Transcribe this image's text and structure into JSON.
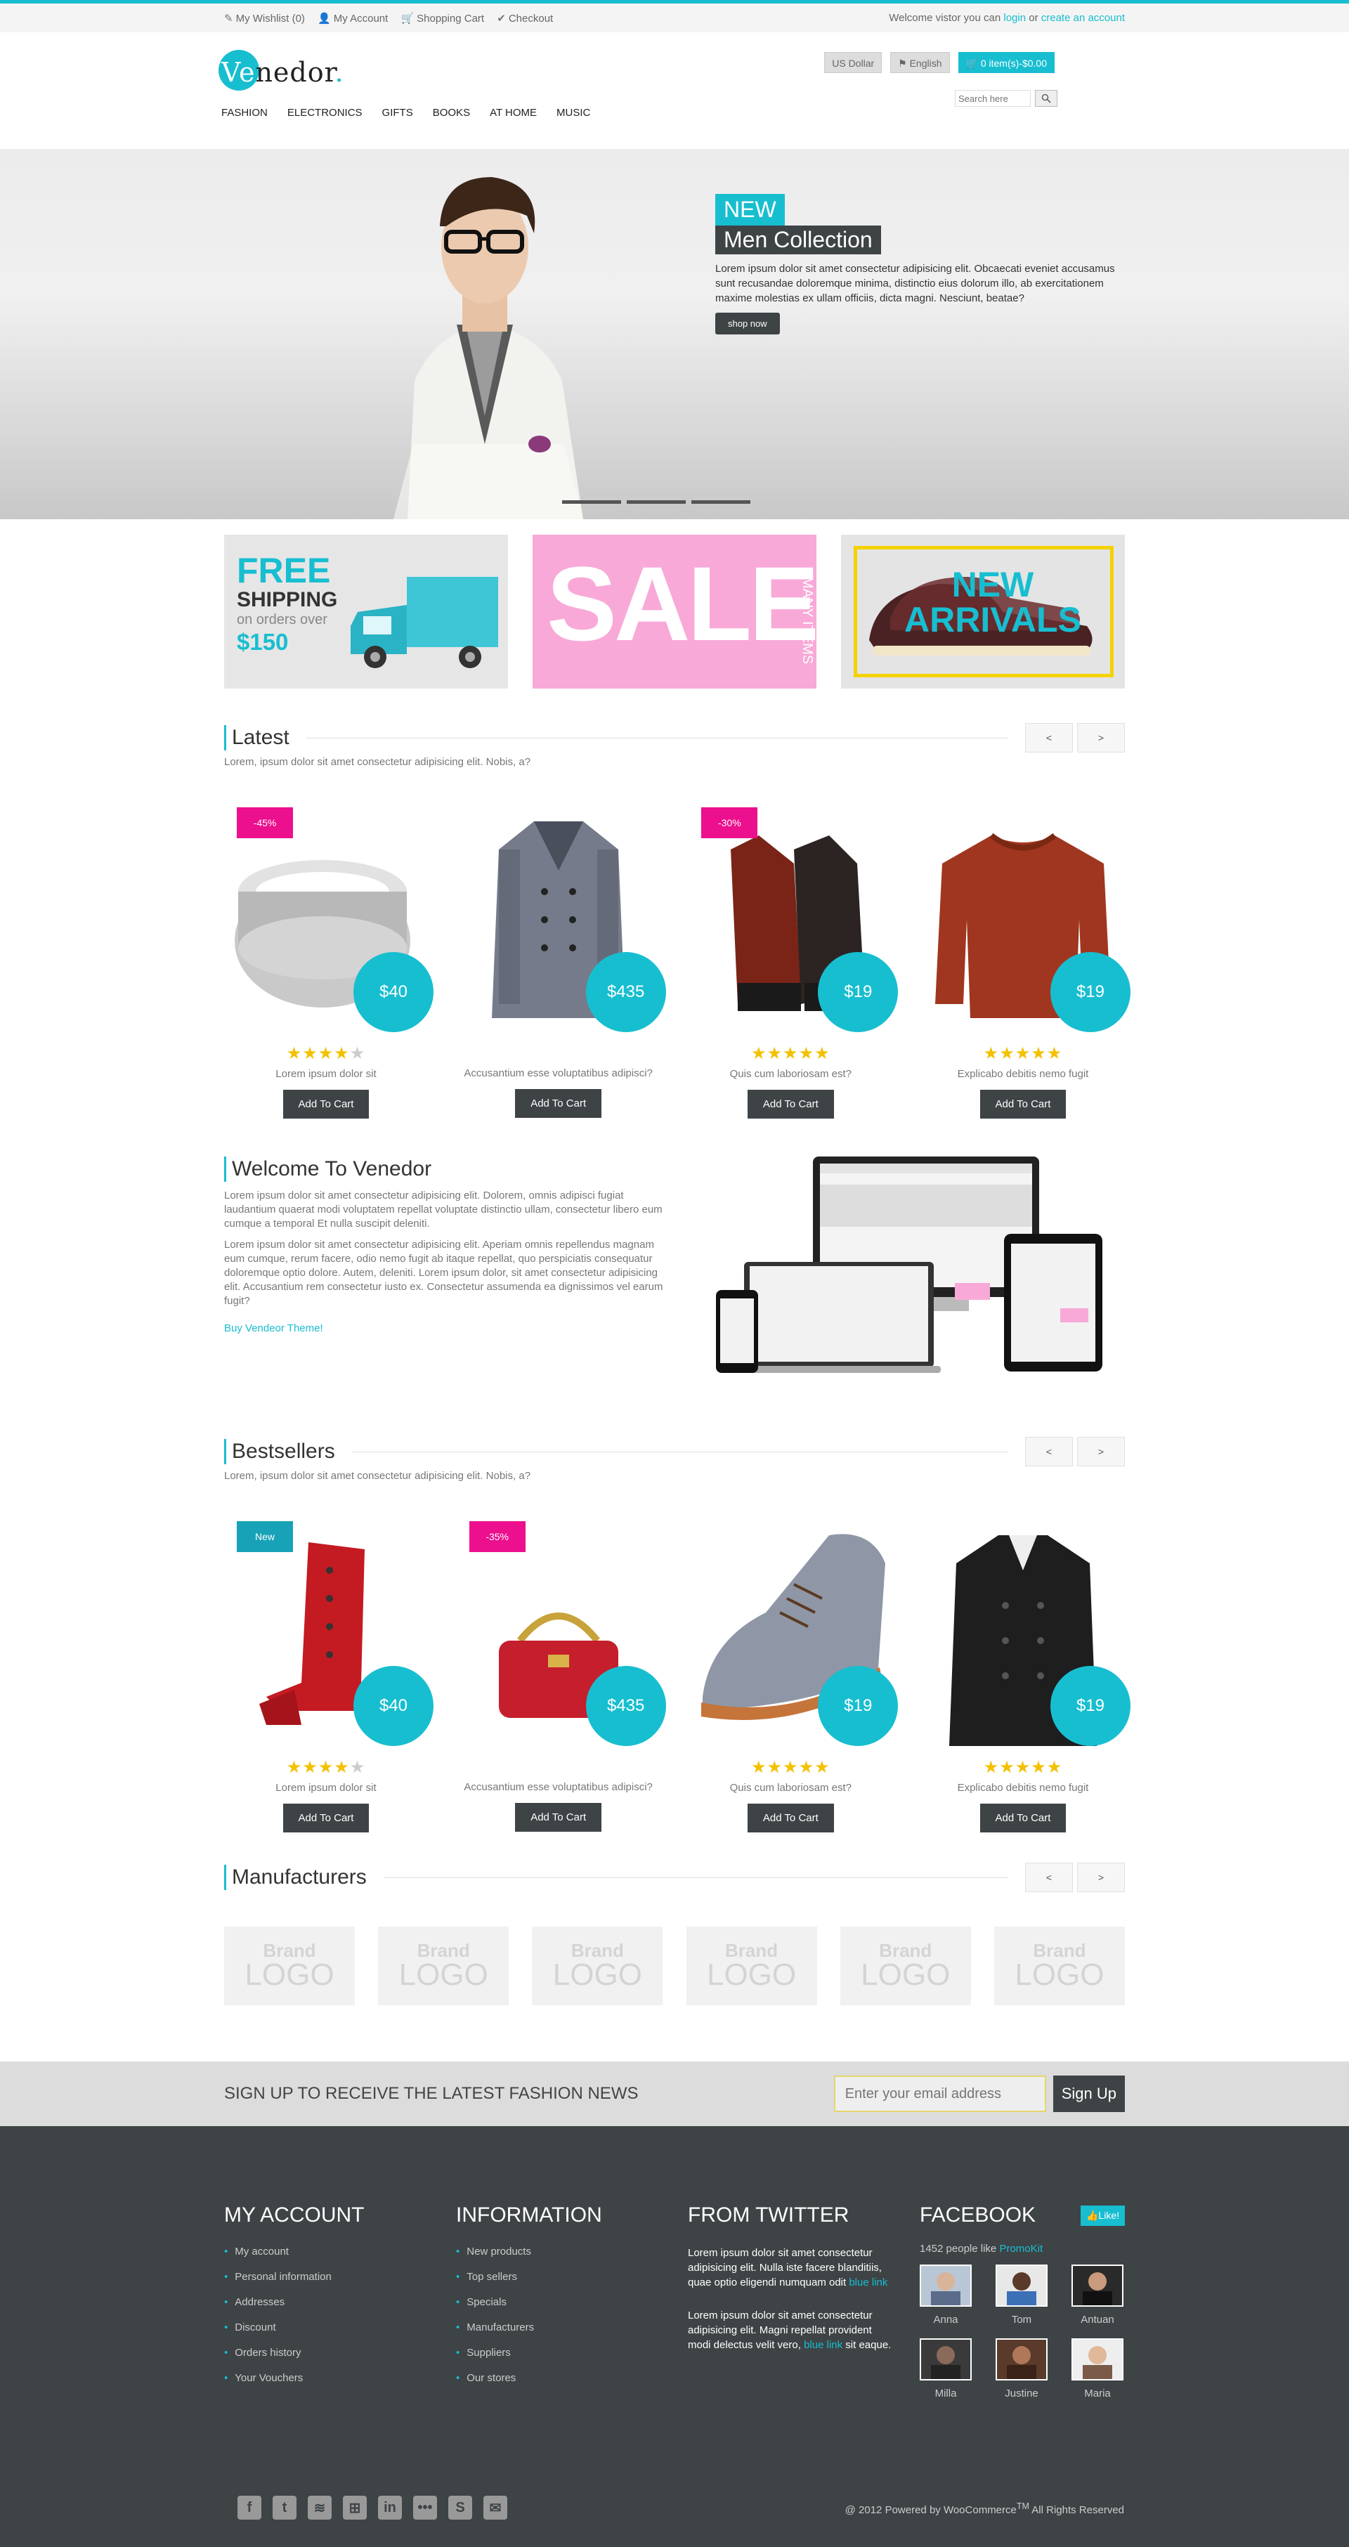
{
  "topbar": {
    "links": [
      "My Wishlist (0)",
      "My Account",
      "Shopping Cart",
      "Checkout"
    ],
    "welcome_text": "Welcome vistor you can",
    "login": "login",
    "or": "or",
    "create": "create an account"
  },
  "header": {
    "logo_ve": "Ve",
    "logo_rest": "nedor",
    "logo_dot": ".",
    "nav": [
      "FASHION",
      "ELECTRONICS",
      "GIFTS",
      "BOOKS",
      "AT HOME",
      "MUSIC"
    ],
    "currency": "US Dollar",
    "language": "English",
    "cart": "0 item(s)-$0.00",
    "search_placeholder": "Search here"
  },
  "hero": {
    "tag": "NEW",
    "title": "Men Collection",
    "desc": "Lorem ipsum dolor sit amet consectetur adipisicing elit. Obcaecati eveniet accusamus sunt recusandae doloremque minima, distinctio eius dolorum illo, ab exercitationem maxime molestias ex ullam officiis, dicta magni. Nesciunt, beatae?",
    "button": "shop now"
  },
  "banners": {
    "free": "FREE",
    "shipping": "SHIPPING",
    "on_orders": "on orders over",
    "amount": "$150",
    "sale": "SALE",
    "many": "MANY ITEMS",
    "new_arrivals_1": "NEW",
    "new_arrivals_2": "ARRIVALS"
  },
  "latest": {
    "title": "Latest",
    "sub": "Lorem, ipsum dolor sit amet consectetur adipisicing elit. Nobis, a?",
    "prev": "<",
    "next": ">",
    "products": [
      {
        "badge": "-45%",
        "price": "$40",
        "rating": 4,
        "name": "Lorem ipsum dolor sit",
        "cart": "Add To Cart"
      },
      {
        "badge": "",
        "price": "$435",
        "rating": 0,
        "name": "Accusantium esse voluptatibus adipisci?",
        "cart": "Add To Cart"
      },
      {
        "badge": "-30%",
        "price": "$19",
        "rating": 5,
        "name": "Quis cum laboriosam est?",
        "cart": "Add To Cart"
      },
      {
        "badge": "",
        "price": "$19",
        "rating": 5,
        "name": "Explicabo debitis nemo fugit",
        "cart": "Add To Cart"
      }
    ]
  },
  "welcome": {
    "title": "Welcome To Venedor",
    "p1": "Lorem ipsum dolor sit amet consectetur adipisicing elit. Dolorem, omnis adipisci fugiat laudantium quaerat modi voluptatem repellat voluptate distinctio ullam, consectetur libero eum cumque a temporal Et nulla suscipit deleniti.",
    "p2": "Lorem ipsum dolor sit amet consectetur adipisicing elit. Aperiam omnis repellendus magnam eum cumque, rerum facere, odio nemo fugit ab itaque repellat, quo perspiciatis consequatur doloremque optio dolore. Autem, deleniti. Lorem ipsum dolor, sit amet consectetur adipisicing elit. Accusantium rem consectetur iusto ex. Consectetur assumenda ea dignissimos vel earum fugit?",
    "link": "Buy Vendeor Theme!"
  },
  "bestsellers": {
    "title": "Bestsellers",
    "sub": "Lorem, ipsum dolor sit amet consectetur adipisicing elit. Nobis, a?",
    "prev": "<",
    "next": ">",
    "products": [
      {
        "badge": "New",
        "price": "$40",
        "rating": 4,
        "name": "Lorem ipsum dolor sit",
        "cart": "Add To Cart"
      },
      {
        "badge": "-35%",
        "price": "$435",
        "rating": 0,
        "name": "Accusantium esse voluptatibus adipisci?",
        "cart": "Add To Cart"
      },
      {
        "badge": "",
        "price": "$19",
        "rating": 5,
        "name": "Quis cum laboriosam est?",
        "cart": "Add To Cart"
      },
      {
        "badge": "",
        "price": "$19",
        "rating": 5,
        "name": "Explicabo debitis nemo fugit",
        "cart": "Add To Cart"
      }
    ]
  },
  "manufacturers": {
    "title": "Manufacturers",
    "prev": "<",
    "next": ">",
    "brand_top": "Brand",
    "brand_bottom": "LOGO"
  },
  "newsletter": {
    "title": "SIGN UP TO RECEIVE THE LATEST FASHION NEWS",
    "placeholder": "Enter your email address",
    "button": "Sign Up"
  },
  "footer": {
    "account_title": "MY ACCOUNT",
    "account_links": [
      "My account",
      "Personal information",
      "Addresses",
      "Discount",
      "Orders history",
      "Your Vouchers"
    ],
    "info_title": "INFORMATION",
    "info_links": [
      "New products",
      "Top sellers",
      "Specials",
      "Manufacturers",
      "Suppliers",
      "Our stores"
    ],
    "twitter_title": "FROM TWITTER",
    "tweet1": "Lorem ipsum dolor sit amet consectetur adipisicing elit. Nulla iste facere blanditiis, quae optio eligendi numquam odit",
    "tweet1_link": "blue link",
    "tweet2": "Lorem ipsum dolor sit amet consectetur adipisicing elit. Magni repellat provident modi delectus velit vero,",
    "tweet2_link": "blue link",
    "tweet2_end": "sit eaque.",
    "facebook_title": "FACEBOOK",
    "like": "Like!",
    "fb_count": "1452 people like",
    "fb_page": "PromoKit",
    "faces": [
      "Anna",
      "Tom",
      "Antuan",
      "Milla",
      "Justine",
      "Maria"
    ],
    "copyright": "@ 2012 Powered by WooCommerce",
    "tm": "TM",
    "rights": "All Rights Reserved"
  }
}
